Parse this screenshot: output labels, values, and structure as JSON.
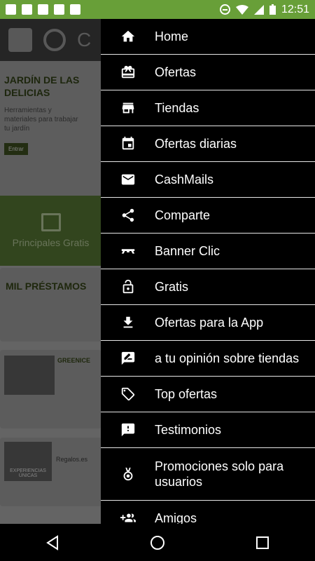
{
  "status_bar": {
    "time": "12:51"
  },
  "background_app": {
    "title_fragment": "C",
    "banner": {
      "title": "JARDÍN DE LAS DELICIAS",
      "subtitle": "Herramientas y materiales para trabajar tu jardín",
      "button": "Entrar"
    },
    "free_tab_label": "Principales Gratis",
    "card1_logo": "MIL PRÉSTAMOS",
    "card2_logo": "GREENICE",
    "card3_thumb_text": "EXPERIENCIAS ÚNICAS",
    "card3_logo": "Regalos.es"
  },
  "drawer": {
    "items": [
      {
        "label": "Home",
        "icon": "home-icon"
      },
      {
        "label": "Ofertas",
        "icon": "card-giftcard-icon"
      },
      {
        "label": "Tiendas",
        "icon": "store-icon"
      },
      {
        "label": "Ofertas diarias",
        "icon": "calendar-icon"
      },
      {
        "label": "CashMails",
        "icon": "mail-icon"
      },
      {
        "label": "Comparte",
        "icon": "share-icon"
      },
      {
        "label": "Banner Clic",
        "icon": "banner-icon"
      },
      {
        "label": "Gratis",
        "icon": "lock-open-icon"
      },
      {
        "label": "Ofertas para la App",
        "icon": "download-icon"
      },
      {
        "label": "a tu opinión sobre tiendas",
        "icon": "feedback-edit-icon"
      },
      {
        "label": "Top ofertas",
        "icon": "tag-icon"
      },
      {
        "label": "Testimonios",
        "icon": "feedback-icon"
      },
      {
        "label": "Promociones solo para usuarios",
        "icon": "medal-icon"
      },
      {
        "label": "Amigos",
        "icon": "group-add-icon"
      }
    ]
  }
}
